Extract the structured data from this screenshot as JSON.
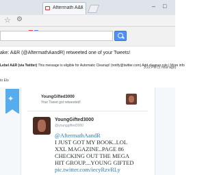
{
  "browser": {
    "tab_title": "Aftermath A&R (@Aftermat"
  },
  "email": {
    "subject": "ake: A&R (@AftermathAandR) retweeted one of your Tweets!",
    "sender": "Lebel A&R (via Twitter)",
    "snippet": "This message is eligible for Automatic Cleanup! (notify@twitter.com) Add cleanup rule | More info",
    "date": "3:22 PM (1 hour ago)",
    "to_label": "to Elo"
  },
  "notification": {
    "username": "YoungGifted3000",
    "message": "Your Tweet got retweeted!"
  },
  "tweet": {
    "name": "YoungGifted3000",
    "handle": "@younggifted3000",
    "lines": [
      "@AftermathAandR",
      "I JUST GOT MY BOOK..LOL",
      "XXL MAGAZINE..PAGE 86",
      "CHECKING OUT THE MEGA",
      "HIT GROUP....YOUNG GIFTED",
      "pic.twitter.com/iecyRzvRLy"
    ]
  },
  "colors": {
    "twitter_blue": "#55acee",
    "search_button": "#4d90fe",
    "link": "#2b7bb9"
  }
}
